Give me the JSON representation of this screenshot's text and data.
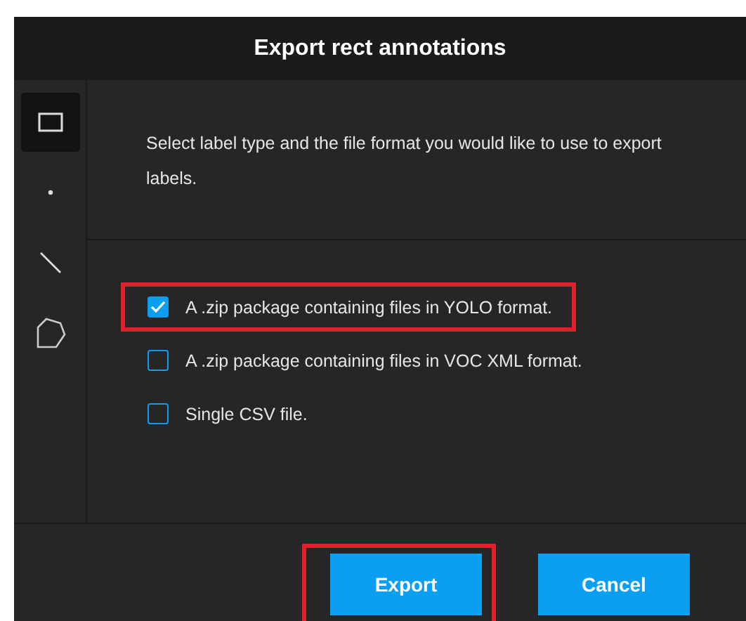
{
  "dialog": {
    "title": "Export rect annotations"
  },
  "tools": [
    {
      "kind": "rect",
      "selected": true
    },
    {
      "kind": "point",
      "selected": false
    },
    {
      "kind": "line",
      "selected": false
    },
    {
      "kind": "polygon",
      "selected": false
    }
  ],
  "description": "Select label type and the file format you would like to use to export labels.",
  "options": [
    {
      "label": "A .zip package containing files in YOLO format.",
      "checked": true,
      "highlighted": true
    },
    {
      "label": "A .zip package containing files in VOC XML format.",
      "checked": false,
      "highlighted": false
    },
    {
      "label": "Single CSV file.",
      "checked": false,
      "highlighted": false
    }
  ],
  "buttons": [
    {
      "label": "Export",
      "highlighted": true
    },
    {
      "label": "Cancel",
      "highlighted": false
    }
  ]
}
